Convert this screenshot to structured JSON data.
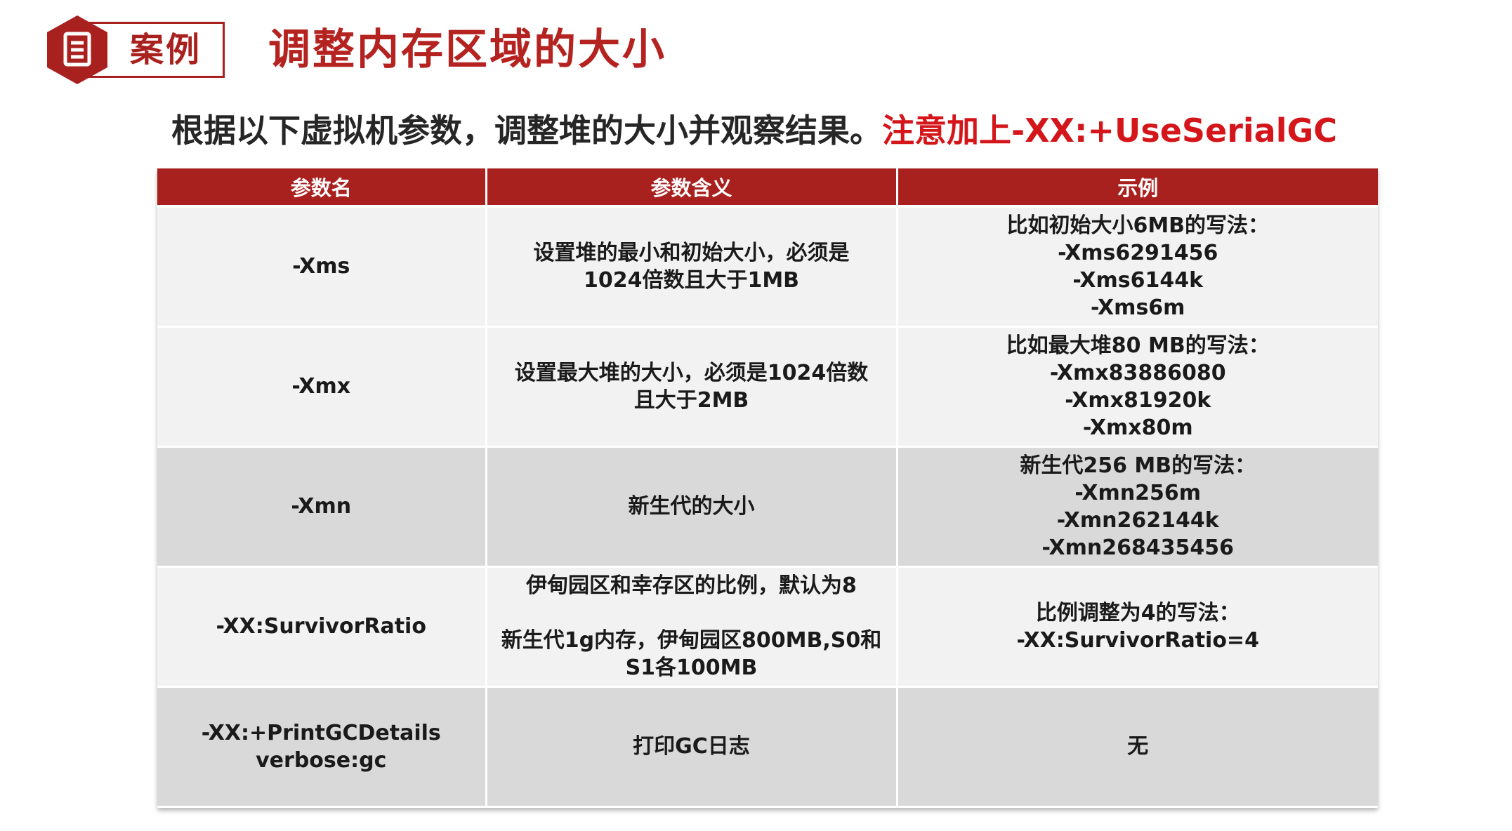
{
  "header": {
    "badge_label": "案例",
    "title": "调整内存区域的大小",
    "accent_color": "#a9211f",
    "icon": "document-icon"
  },
  "subtitle": {
    "text": "根据以下虚拟机参数，调整堆的大小并观察结果。",
    "highlight": "注意加上-XX:+UseSerialGC",
    "highlight_color": "#d4161b"
  },
  "table": {
    "headers": [
      "参数名",
      "参数含义",
      "示例"
    ],
    "rows": [
      {
        "name": [
          "-Xms"
        ],
        "meaning": [
          "设置堆的最小和初始大小，必须是",
          "1024倍数且大于1MB"
        ],
        "example": [
          "比如初始大小6MB的写法：",
          "-Xms6291456",
          "-Xms6144k",
          "-Xms6m"
        ]
      },
      {
        "name": [
          "-Xmx"
        ],
        "meaning": [
          "设置最大堆的大小，必须是1024倍数",
          "且大于2MB"
        ],
        "example": [
          "比如最大堆80 MB的写法：",
          "-Xmx83886080",
          "-Xmx81920k",
          "-Xmx80m"
        ]
      },
      {
        "name": [
          "-Xmn"
        ],
        "meaning": [
          "新生代的大小"
        ],
        "example": [
          "新生代256 MB的写法：",
          "-Xmn256m",
          "-Xmn262144k",
          "-Xmn268435456"
        ]
      },
      {
        "name": [
          "-XX:SurvivorRatio"
        ],
        "meaning": [
          "伊甸园区和幸存区的比例，默认为8",
          "",
          "新生代1g内存，伊甸园区800MB,S0和",
          "S1各100MB"
        ],
        "example": [
          "比例调整为4的写法：",
          "-XX:SurvivorRatio=4"
        ]
      },
      {
        "name": [
          "-XX:+PrintGCDetails",
          "verbose:gc"
        ],
        "meaning": [
          "打印GC日志"
        ],
        "example": [
          "无"
        ]
      }
    ]
  }
}
